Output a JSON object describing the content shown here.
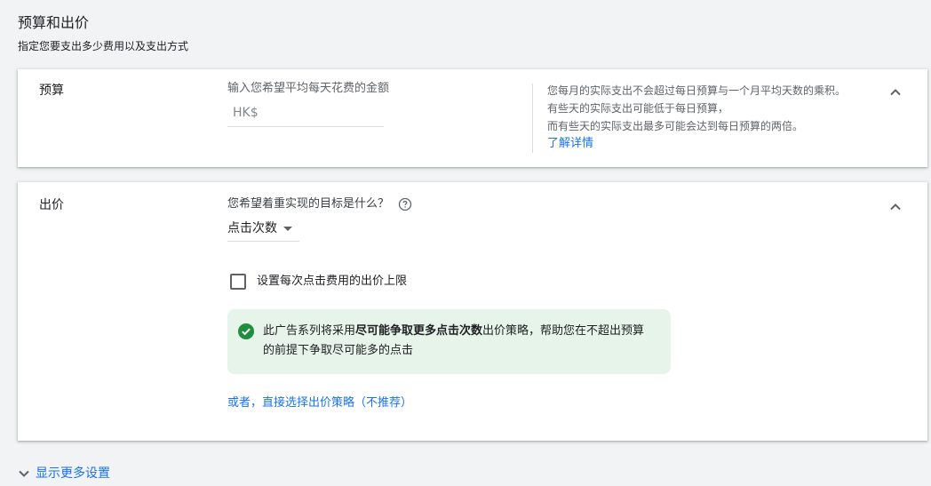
{
  "header": {
    "title": "预算和出价",
    "subtitle": "指定您要支出多少费用以及支出方式"
  },
  "budget": {
    "label": "预算",
    "prompt": "输入您希望平均每天花费的金额",
    "input_placeholder": "HK$",
    "input_value": "",
    "info_lines": [
      "您每月的实际支出不会超过每日预算与一个月平均天数的乘积。",
      "有些天的实际支出可能低于每日预算，",
      "而有些天的实际支出最多可能会达到每日预算的两倍。"
    ],
    "learn_more": "了解详情"
  },
  "bidding": {
    "label": "出价",
    "goal_question": "您希望着重实现的目标是什么？",
    "goal_selected": "点击次数",
    "checkbox_label": "设置每次点击费用的出价上限",
    "checkbox_checked": false,
    "notice": {
      "prefix": "此广告系列将采用",
      "strategy": "尽可能争取更多点击次数",
      "suffix": "出价策略，帮助您在不超出预算的前提下争取尽可能多的点击"
    },
    "alt_link": "或者，直接选择出价策略（不推荐）"
  },
  "footer": {
    "more_settings": "显示更多设置"
  },
  "colors": {
    "background": "#f1f3f4",
    "card": "#ffffff",
    "link": "#1a73e8",
    "success_bg": "#e6f4ea",
    "success_icon": "#1e8e3e"
  },
  "icons": {
    "collapse": "chevron-up-icon",
    "help": "help-circle-icon",
    "dropdown": "arrow-drop-down-icon",
    "success": "check-circle-icon",
    "expand": "chevron-down-icon"
  }
}
